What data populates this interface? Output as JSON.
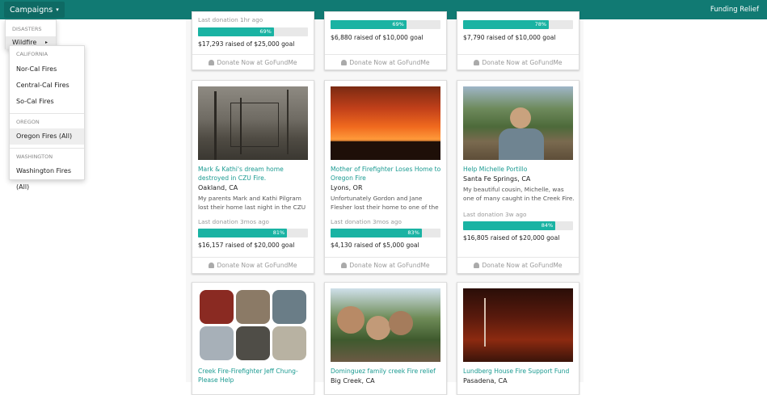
{
  "nav": {
    "campaigns_label": "Campaigns",
    "caret": "▾",
    "brand": "Funding Relief"
  },
  "menu": {
    "disasters_header": "DISASTERS",
    "wildfire_label": "Wildfire",
    "wildfire_arrow": "▸",
    "groups": [
      {
        "header": "CALIFORNIA",
        "items": [
          "Nor-Cal Fires",
          "Central-Cal Fires",
          "So-Cal Fires"
        ]
      },
      {
        "header": "OREGON",
        "items": [
          "Oregon Fires (All)"
        ]
      },
      {
        "header": "WASHINGTON",
        "items": [
          "Washington Fires (All)"
        ]
      }
    ]
  },
  "donate_label": "Donate Now at GoFundMe",
  "cards_top": [
    {
      "last": "Last donation 1hr ago",
      "pct_label": "69%",
      "pct": 69,
      "raised": "$17,293 raised of $25,000 goal"
    },
    {
      "pct_label": "69%",
      "pct": 69,
      "raised": "$6,880 raised of $10,000 goal"
    },
    {
      "pct_label": "78%",
      "pct": 78,
      "raised": "$7,790 raised of $10,000 goal"
    }
  ],
  "cards_mid": [
    {
      "title": "Mark & Kathi's dream home destroyed in CZU Fire.",
      "loc": "Oakland, CA",
      "desc": "My parents Mark and Kathi Pilgram lost their home last night in the CZU Lightning Complex fire.",
      "last": "Last donation 3mos ago",
      "pct_label": "81%",
      "pct": 81,
      "raised": "$16,157 raised of $20,000 goal"
    },
    {
      "title": "Mother of Firefighter Loses Home to Oregon Fire",
      "loc": "Lyons, OR",
      "desc": "Unfortunately Gordon and Jane Flesher lost their home to one of the fires.",
      "last": "Last donation 3mos ago",
      "pct_label": "83%",
      "pct": 83,
      "raised": "$4,130 raised of $5,000 goal"
    },
    {
      "title": "Help Michelle Portillo",
      "loc": "Santa Fe Springs, CA",
      "desc": "My beautiful cousin, Michelle, was one of many caught in the Creek Fire.",
      "last": "Last donation 3w ago",
      "pct_label": "84%",
      "pct": 84,
      "raised": "$16,805 raised of $20,000 goal"
    }
  ],
  "cards_bottom": [
    {
      "title": "Creek Fire-Firefighter Jeff Chung-Please Help"
    },
    {
      "title": "Dominguez family creek Fire relief",
      "loc": "Big Creek, CA"
    },
    {
      "title": "Lundberg House Fire Support Fund",
      "loc": "Pasadena, CA"
    }
  ]
}
